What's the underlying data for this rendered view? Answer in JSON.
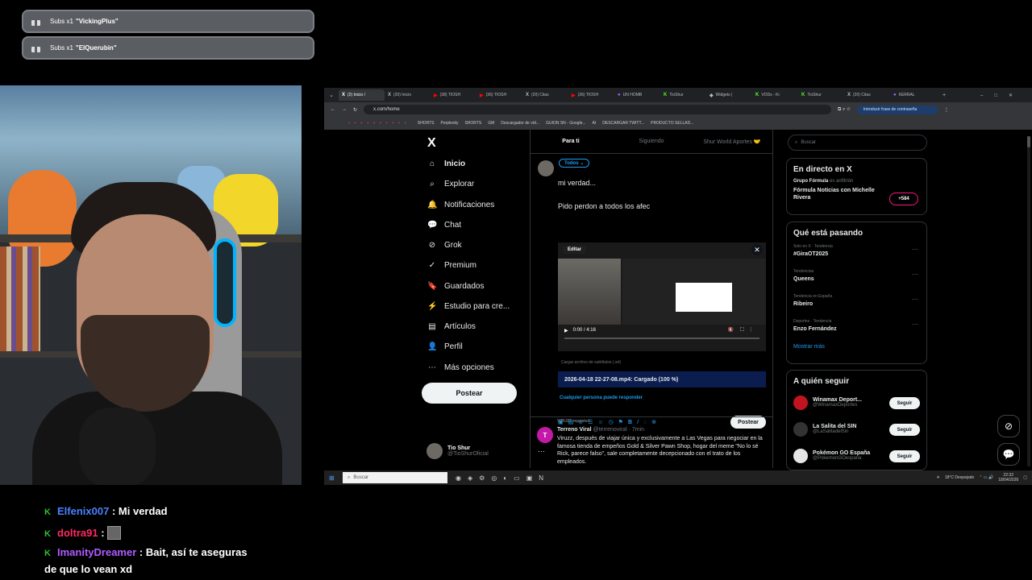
{
  "alerts": [
    {
      "text": "Subs x1",
      "user": "\"VickingPlus\""
    },
    {
      "text": "Subs x1",
      "user": "\"ElQuerubin\""
    }
  ],
  "chat": [
    {
      "user": "Elfenix007",
      "sep": ":",
      "message": "Mi verdad"
    },
    {
      "user": "doltra91",
      "sep": ":",
      "message": ""
    },
    {
      "user": "ImanityDreamer",
      "sep": ":",
      "message": "Bait, así te aseguras",
      "message2": "de que lo vean xd"
    }
  ],
  "browser": {
    "tabs": [
      "(2) Inicio /",
      "(20) Inicio",
      "(38) TIOSH",
      "(36) TIOSH",
      "(20) Citas",
      "(36) TIOSH",
      "UN HOMB",
      "TioShur",
      "Widgets |",
      "VODs - Ki",
      "TioShur",
      "(20) Citas",
      "KERRAL"
    ],
    "url": "x.com/home",
    "password_button": "Introducir frase de contraseña",
    "bookmarks": [
      "SHORTS",
      "Perplexity",
      "SHORTS",
      "GM",
      "Descargador de víd...",
      "GUION SN - Google...",
      "AI",
      "DESCARGAR TWITT...",
      "PRODUCTO SELLAD..."
    ]
  },
  "x": {
    "logo": "X",
    "nav": [
      {
        "icon": "⌂",
        "label": "Inicio"
      },
      {
        "icon": "⌕",
        "label": "Explorar"
      },
      {
        "icon": "🔔",
        "label": "Notificaciones"
      },
      {
        "icon": "💬",
        "label": "Chat"
      },
      {
        "icon": "⊘",
        "label": "Grok"
      },
      {
        "icon": "✓",
        "label": "Premium"
      },
      {
        "icon": "🔖",
        "label": "Guardados"
      },
      {
        "icon": "⚡",
        "label": "Estudio para cre..."
      },
      {
        "icon": "▤",
        "label": "Artículos"
      },
      {
        "icon": "👤",
        "label": "Perfil"
      },
      {
        "icon": "⋯",
        "label": "Más opciones"
      }
    ],
    "post_button": "Postear",
    "profile": {
      "name": "Tio Shur",
      "handle": "@TioShurOficial"
    },
    "tabs": [
      "Para ti",
      "Siguiendo",
      "Shur World Aportes 🤝"
    ],
    "compose": {
      "audience": "Todos ⌄",
      "line1": "mi verdad...",
      "line2": "Pido perdon a todos los afec",
      "edit_label": "Editar",
      "time": "0:00 / 4:16",
      "subtitles": "Cargar archivo de subtítulos (.srt)",
      "upload": "2026-04-18 22-27-08.mp4: Cargado (100 %)",
      "reply": "Cualquier persona puede responder",
      "post": "Postear"
    },
    "feed": {
      "reposted": "VIRUZZ reposteó",
      "author": "Terreno Viral",
      "meta": "@terrenoviral · 7min",
      "text": "Viruzz, después de viajar única y exclusivamente a Las Vegas para negociar en la famosa tienda de empeños Gold & Silver Pawn Shop, hogar del meme \"No lo sé Rick, parece falso\", sale completamente decepcionado con el trato de los empleados."
    },
    "search_placeholder": "Buscar",
    "live": {
      "title": "En directo en X",
      "host": "Grupo Fórmula",
      "host_suffix": "es anfitrión",
      "name": "Fórmula Noticias con Michelle Rivera",
      "count": "+584"
    },
    "trends": {
      "title": "Qué está pasando",
      "items": [
        {
          "context": "Solo en X · Tendencia",
          "topic": "#GiraOT2025"
        },
        {
          "context": "Tendencias",
          "topic": "Queens"
        },
        {
          "context": "Tendencia en España",
          "topic": "Ribeiro"
        },
        {
          "context": "Deportes · Tendencia",
          "topic": "Enzo Fernández"
        }
      ],
      "more": "Mostrar más"
    },
    "follow": {
      "title": "A quién seguir",
      "items": [
        {
          "name": "Winamax Deport...",
          "handle": "@WinamaxDeportes",
          "button": "Seguir"
        },
        {
          "name": "La Salita del SIN",
          "handle": "@LaSalitadelSin",
          "button": "Seguir"
        },
        {
          "name": "Pokémon GO España",
          "handle": "@PokemonGOespana",
          "button": "Seguir"
        }
      ]
    }
  },
  "taskbar": {
    "search": "Buscar",
    "weather": "18°C  Despejado",
    "time": "22:32",
    "date": "18/04/2026"
  }
}
